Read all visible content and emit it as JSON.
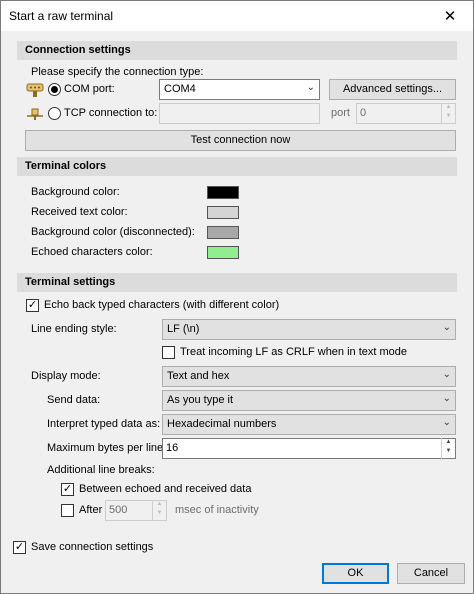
{
  "window": {
    "title": "Start a raw terminal",
    "close_glyph": "✕"
  },
  "connection": {
    "header": "Connection settings",
    "instruction": "Please specify the connection type:",
    "com_label": "COM port:",
    "com_value": "COM4",
    "advanced_button": "Advanced settings...",
    "tcp_label": "TCP connection to:",
    "tcp_value": "",
    "port_label": "port",
    "port_value": "0",
    "test_button": "Test connection now",
    "selected_type": "com"
  },
  "colors": {
    "header": "Terminal colors",
    "background_label": "Background color:",
    "background_color": "#000000",
    "received_label": "Received text color:",
    "received_color": "#d4d4d4",
    "disconnected_label": "Background color (disconnected):",
    "disconnected_color": "#a8a8a8",
    "echoed_label": "Echoed characters color:",
    "echoed_color": "#90ee90"
  },
  "terminal": {
    "header": "Terminal settings",
    "echo_label": "Echo back typed characters (with different color)",
    "echo_checked": true,
    "line_ending_label": "Line ending style:",
    "line_ending_value": "LF (\\n)",
    "treat_lf_label": "Treat incoming LF as CRLF when in text mode",
    "treat_lf_checked": false,
    "display_mode_label": "Display mode:",
    "display_mode_value": "Text and hex",
    "send_data_label": "Send data:",
    "send_data_value": "As you type it",
    "interpret_label": "Interpret typed data as:",
    "interpret_value": "Hexadecimal numbers",
    "max_bytes_label": "Maximum bytes per line:",
    "max_bytes_value": "16",
    "line_breaks_label": "Additional line breaks:",
    "between_label": "Between echoed and received data",
    "between_checked": true,
    "after_label": "After",
    "after_checked": false,
    "after_value": "500",
    "after_units": "msec of inactivity"
  },
  "footer": {
    "save_label": "Save connection settings",
    "save_checked": true,
    "ok_button": "OK",
    "cancel_button": "Cancel"
  },
  "icons": {
    "check": "✓",
    "dropdown": "⌄",
    "spin_up": "▲",
    "spin_down": "▼"
  }
}
